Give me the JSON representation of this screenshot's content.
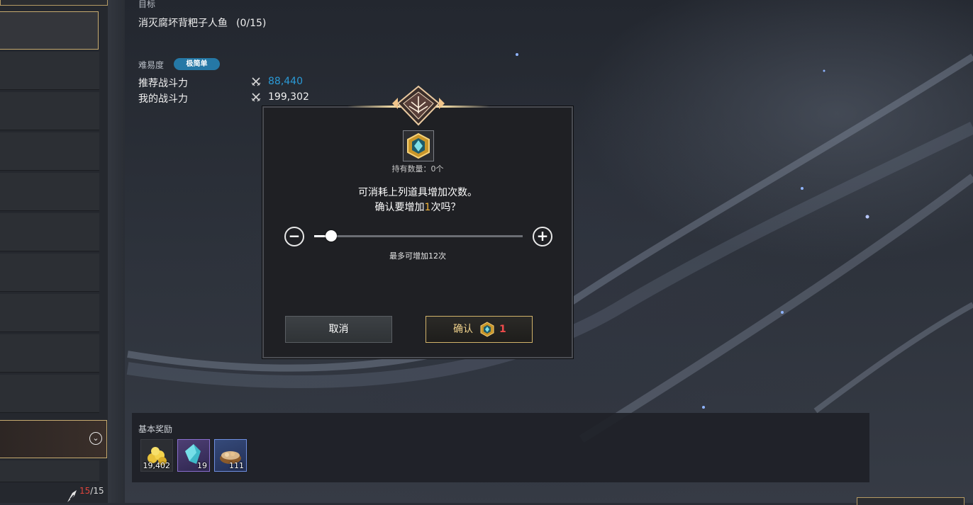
{
  "quest": {
    "objective_label": "目标",
    "objective_text": "消灭腐坏背粑子人鱼",
    "objective_progress": "(0/15)",
    "difficulty_label": "难易度",
    "difficulty_value": "极简单",
    "recommended_power_label": "推荐战斗力",
    "recommended_power_value": "88,440",
    "my_power_label": "我的战斗力",
    "my_power_value": "199,302"
  },
  "left_panel": {
    "entry_count_current": "15",
    "entry_count_total": "/15",
    "dropdown_icon": "chevron-down-icon"
  },
  "dialog": {
    "hold_text": "持有数量：0个",
    "message_line1": "可消耗上列道具增加次数。",
    "message_line2_pre": "确认要增加",
    "message_line2_num": "1",
    "message_line2_post": "次吗？",
    "slider": {
      "current": 1,
      "max": 12,
      "value_fraction": 0.083
    },
    "max_text": "最多可增加12次",
    "minus_glyph": "−",
    "plus_glyph": "+",
    "cancel_label": "取消",
    "confirm_label": "确认",
    "confirm_cost": "1"
  },
  "rewards": {
    "title": "基本奖励",
    "items": [
      {
        "name": "gold-coins-icon",
        "qty": "19,402"
      },
      {
        "name": "blue-crystal-icon",
        "qty": "19"
      },
      {
        "name": "material-bowl-icon",
        "qty": "111"
      }
    ]
  },
  "colors": {
    "accent_blue": "#2a9ad6",
    "gold_border": "#c7ab70",
    "cost_red": "#ef4b4b",
    "highlight_orange": "#f0b43a"
  }
}
